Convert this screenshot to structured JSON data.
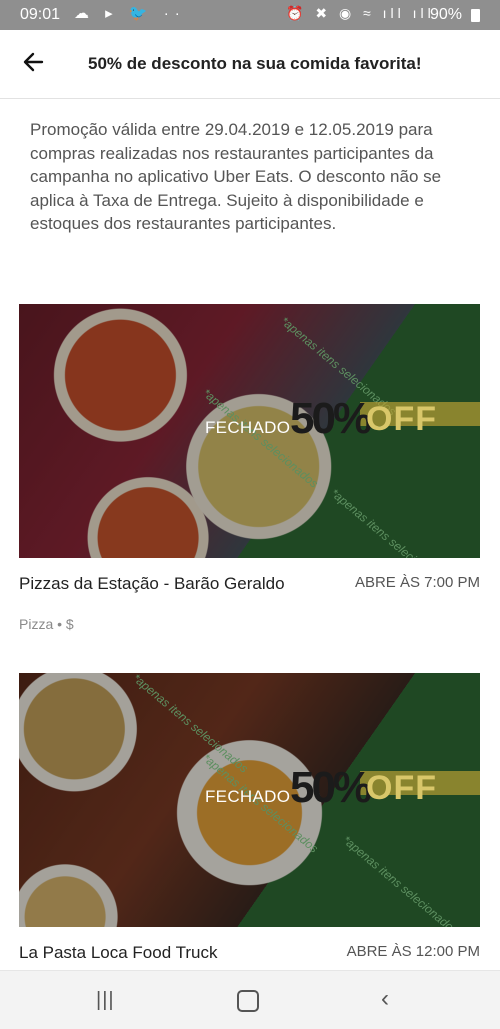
{
  "status_bar": {
    "time": "09:01",
    "battery": "90%",
    "icons": [
      "cloud-icon",
      "send-icon",
      "twitter-icon",
      "more-icon",
      "alarm-icon",
      "mute-icon",
      "location-icon",
      "wifi-icon",
      "signal-icon",
      "signal-icon",
      "battery-icon"
    ]
  },
  "header": {
    "title": "50% de desconto na sua comida favorita!"
  },
  "description": "Promoção válida entre 29.04.2019 e 12.05.2019 para compras realizadas nos restaurantes participantes da campanha no aplicativo Uber Eats. O desconto não se aplica à Taxa de Entrega. Sujeito à disponibilidade e estoques dos restaurantes participantes.",
  "restaurants": [
    {
      "name": "Pizzas da Estação - Barão Geraldo",
      "opening": "ABRE ÀS 7:00 PM",
      "meta": "Pizza • $",
      "status": "FECHADO",
      "promo_big": "50%",
      "promo_off": "OFF",
      "ribbon": "*apenas itens selecionados"
    },
    {
      "name": "La Pasta Loca Food Truck",
      "opening": "ABRE ÀS 12:00 PM",
      "status": "FECHADO",
      "promo_big": "50%",
      "promo_off": "OFF",
      "ribbon": "*apenas itens selecionados"
    }
  ],
  "colors": {
    "promo_green": "#2e6b34",
    "status_bar": "#8f8f8f"
  }
}
